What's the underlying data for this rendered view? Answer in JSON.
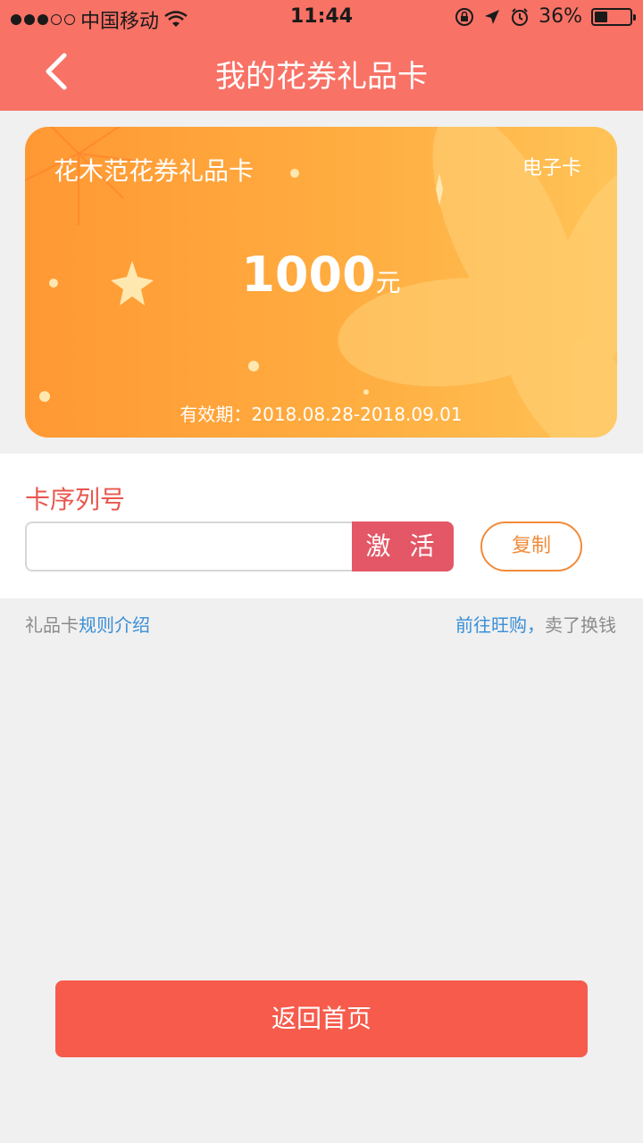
{
  "status_bar": {
    "carrier": "中国移动",
    "time": "11:44",
    "battery": "36%"
  },
  "header": {
    "title": "我的花券礼品卡"
  },
  "card": {
    "name": "花木范花券礼品卡",
    "type": "电子卡",
    "amount": "1000",
    "unit": "元",
    "validity": "有效期：2018.08.28-2018.09.01"
  },
  "serial": {
    "label": "卡序列号",
    "input_value": "",
    "activate_label": "激 活",
    "copy_label": "复制"
  },
  "links": {
    "rules_prefix": "礼品卡",
    "rules_link": "规则介绍",
    "shop_link": "前往旺购，",
    "shop_suffix": "卖了换钱"
  },
  "footer": {
    "home_button": "返回首页"
  },
  "colors": {
    "header_bg": "#f87266",
    "accent_red": "#e9564e",
    "activate_bg": "#e35766",
    "copy_border": "#f28b3a",
    "link_blue": "#3a8fd6",
    "home_bg": "#f65b4c"
  }
}
